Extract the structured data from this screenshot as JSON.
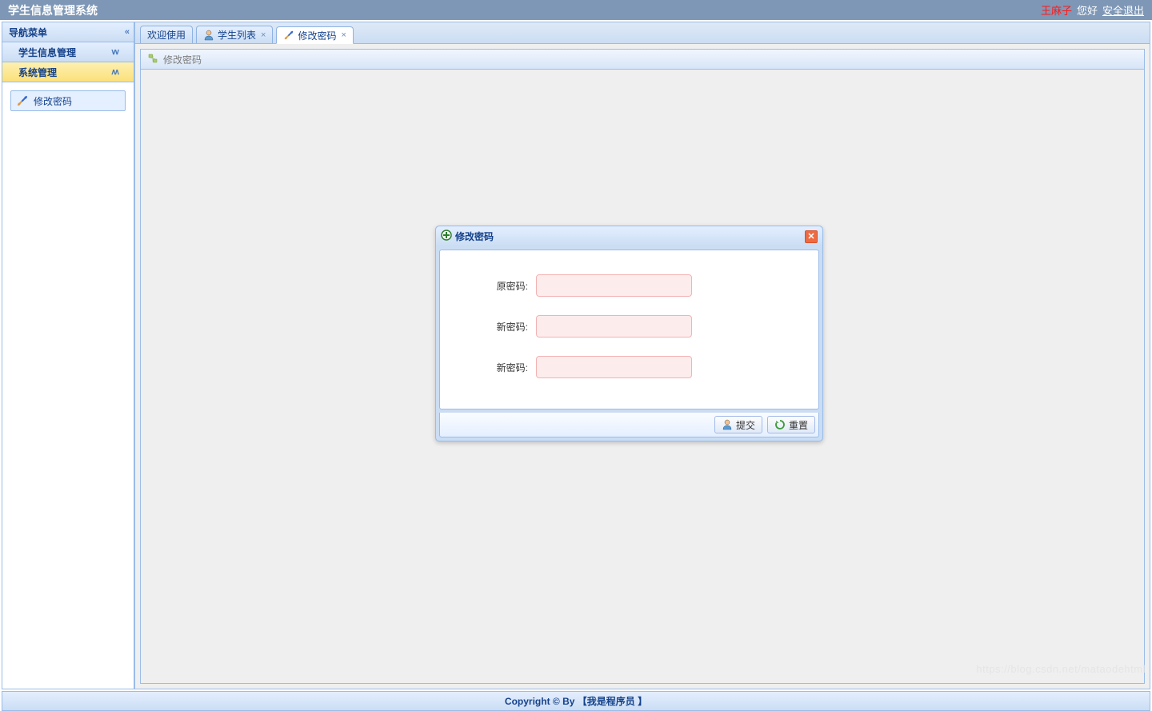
{
  "header": {
    "title": "学生信息管理系统",
    "user": "王麻子",
    "greeting": "您好",
    "logout": "安全退出"
  },
  "sidebar": {
    "title": "导航菜单",
    "groups": [
      {
        "label": "学生信息管理"
      },
      {
        "label": "系统管理"
      }
    ],
    "tree": {
      "change_password": "修改密码"
    }
  },
  "tabs": {
    "welcome": "欢迎使用",
    "student_list": "学生列表",
    "change_password": "修改密码"
  },
  "panel": {
    "title": "修改密码"
  },
  "dialog": {
    "title": "修改密码",
    "fields": {
      "old_password": "原密码:",
      "new_password1": "新密码:",
      "new_password2": "新密码:"
    },
    "buttons": {
      "submit": "提交",
      "reset": "重置"
    }
  },
  "footer": {
    "text": "Copyright © By 【我是程序员 】"
  },
  "watermark": "https://blog.csdn.net/mataodehtml"
}
